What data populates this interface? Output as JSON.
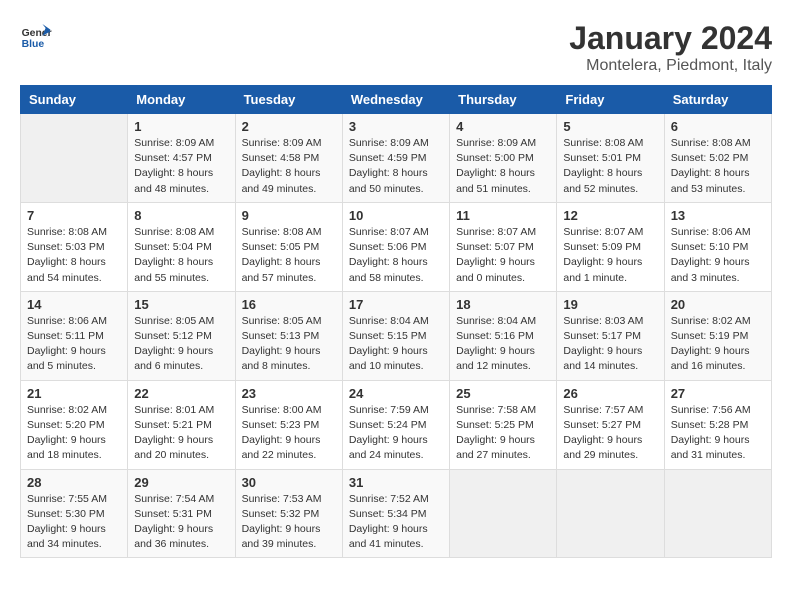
{
  "logo": {
    "line1": "General",
    "line2": "Blue"
  },
  "title": "January 2024",
  "subtitle": "Montelera, Piedmont, Italy",
  "header_days": [
    "Sunday",
    "Monday",
    "Tuesday",
    "Wednesday",
    "Thursday",
    "Friday",
    "Saturday"
  ],
  "weeks": [
    [
      {
        "num": "",
        "detail": ""
      },
      {
        "num": "1",
        "detail": "Sunrise: 8:09 AM\nSunset: 4:57 PM\nDaylight: 8 hours\nand 48 minutes."
      },
      {
        "num": "2",
        "detail": "Sunrise: 8:09 AM\nSunset: 4:58 PM\nDaylight: 8 hours\nand 49 minutes."
      },
      {
        "num": "3",
        "detail": "Sunrise: 8:09 AM\nSunset: 4:59 PM\nDaylight: 8 hours\nand 50 minutes."
      },
      {
        "num": "4",
        "detail": "Sunrise: 8:09 AM\nSunset: 5:00 PM\nDaylight: 8 hours\nand 51 minutes."
      },
      {
        "num": "5",
        "detail": "Sunrise: 8:08 AM\nSunset: 5:01 PM\nDaylight: 8 hours\nand 52 minutes."
      },
      {
        "num": "6",
        "detail": "Sunrise: 8:08 AM\nSunset: 5:02 PM\nDaylight: 8 hours\nand 53 minutes."
      }
    ],
    [
      {
        "num": "7",
        "detail": "Sunrise: 8:08 AM\nSunset: 5:03 PM\nDaylight: 8 hours\nand 54 minutes."
      },
      {
        "num": "8",
        "detail": "Sunrise: 8:08 AM\nSunset: 5:04 PM\nDaylight: 8 hours\nand 55 minutes."
      },
      {
        "num": "9",
        "detail": "Sunrise: 8:08 AM\nSunset: 5:05 PM\nDaylight: 8 hours\nand 57 minutes."
      },
      {
        "num": "10",
        "detail": "Sunrise: 8:07 AM\nSunset: 5:06 PM\nDaylight: 8 hours\nand 58 minutes."
      },
      {
        "num": "11",
        "detail": "Sunrise: 8:07 AM\nSunset: 5:07 PM\nDaylight: 9 hours\nand 0 minutes."
      },
      {
        "num": "12",
        "detail": "Sunrise: 8:07 AM\nSunset: 5:09 PM\nDaylight: 9 hours\nand 1 minute."
      },
      {
        "num": "13",
        "detail": "Sunrise: 8:06 AM\nSunset: 5:10 PM\nDaylight: 9 hours\nand 3 minutes."
      }
    ],
    [
      {
        "num": "14",
        "detail": "Sunrise: 8:06 AM\nSunset: 5:11 PM\nDaylight: 9 hours\nand 5 minutes."
      },
      {
        "num": "15",
        "detail": "Sunrise: 8:05 AM\nSunset: 5:12 PM\nDaylight: 9 hours\nand 6 minutes."
      },
      {
        "num": "16",
        "detail": "Sunrise: 8:05 AM\nSunset: 5:13 PM\nDaylight: 9 hours\nand 8 minutes."
      },
      {
        "num": "17",
        "detail": "Sunrise: 8:04 AM\nSunset: 5:15 PM\nDaylight: 9 hours\nand 10 minutes."
      },
      {
        "num": "18",
        "detail": "Sunrise: 8:04 AM\nSunset: 5:16 PM\nDaylight: 9 hours\nand 12 minutes."
      },
      {
        "num": "19",
        "detail": "Sunrise: 8:03 AM\nSunset: 5:17 PM\nDaylight: 9 hours\nand 14 minutes."
      },
      {
        "num": "20",
        "detail": "Sunrise: 8:02 AM\nSunset: 5:19 PM\nDaylight: 9 hours\nand 16 minutes."
      }
    ],
    [
      {
        "num": "21",
        "detail": "Sunrise: 8:02 AM\nSunset: 5:20 PM\nDaylight: 9 hours\nand 18 minutes."
      },
      {
        "num": "22",
        "detail": "Sunrise: 8:01 AM\nSunset: 5:21 PM\nDaylight: 9 hours\nand 20 minutes."
      },
      {
        "num": "23",
        "detail": "Sunrise: 8:00 AM\nSunset: 5:23 PM\nDaylight: 9 hours\nand 22 minutes."
      },
      {
        "num": "24",
        "detail": "Sunrise: 7:59 AM\nSunset: 5:24 PM\nDaylight: 9 hours\nand 24 minutes."
      },
      {
        "num": "25",
        "detail": "Sunrise: 7:58 AM\nSunset: 5:25 PM\nDaylight: 9 hours\nand 27 minutes."
      },
      {
        "num": "26",
        "detail": "Sunrise: 7:57 AM\nSunset: 5:27 PM\nDaylight: 9 hours\nand 29 minutes."
      },
      {
        "num": "27",
        "detail": "Sunrise: 7:56 AM\nSunset: 5:28 PM\nDaylight: 9 hours\nand 31 minutes."
      }
    ],
    [
      {
        "num": "28",
        "detail": "Sunrise: 7:55 AM\nSunset: 5:30 PM\nDaylight: 9 hours\nand 34 minutes."
      },
      {
        "num": "29",
        "detail": "Sunrise: 7:54 AM\nSunset: 5:31 PM\nDaylight: 9 hours\nand 36 minutes."
      },
      {
        "num": "30",
        "detail": "Sunrise: 7:53 AM\nSunset: 5:32 PM\nDaylight: 9 hours\nand 39 minutes."
      },
      {
        "num": "31",
        "detail": "Sunrise: 7:52 AM\nSunset: 5:34 PM\nDaylight: 9 hours\nand 41 minutes."
      },
      {
        "num": "",
        "detail": ""
      },
      {
        "num": "",
        "detail": ""
      },
      {
        "num": "",
        "detail": ""
      }
    ]
  ]
}
